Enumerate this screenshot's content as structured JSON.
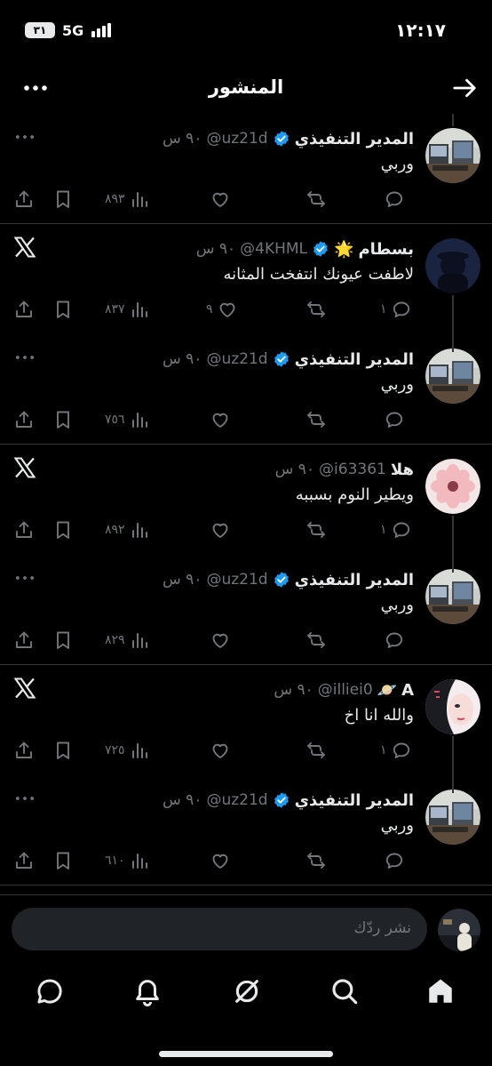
{
  "status_bar": {
    "time": "١٢:١٧",
    "network": "5G",
    "battery": "٣١"
  },
  "header": {
    "title": "المنشور",
    "back_icon": "arrow-right-icon",
    "more_icon": "more-horizontal-icon"
  },
  "posts": [
    {
      "name": "المدير التنفيذي",
      "handle": "@uz21d",
      "time": "٩٠ س",
      "verified": true,
      "emoji": "",
      "text": "وربي",
      "replies": "",
      "likes": "",
      "views": "٨٩٣",
      "avatar": "room",
      "corner": "more"
    },
    {
      "name": "بسطام",
      "handle": "@4KHML",
      "time": "٩٠ س",
      "verified": true,
      "emoji": "🌟",
      "text": "لاطفت عيونك انتفخت المثانه",
      "replies": "١",
      "likes": "٩",
      "views": "٨٣٧",
      "avatar": "night",
      "corner": "x"
    },
    {
      "name": "المدير التنفيذي",
      "handle": "@uz21d",
      "time": "٩٠ س",
      "verified": true,
      "emoji": "",
      "text": "وربي",
      "replies": "",
      "likes": "",
      "views": "٧٥٦",
      "avatar": "room",
      "corner": "more"
    },
    {
      "name": "هلا",
      "handle": "@i63361",
      "time": "٩٠ س",
      "verified": false,
      "emoji": "",
      "text": "ويطير النوم بسببه",
      "replies": "١",
      "likes": "",
      "views": "٨٩٢",
      "avatar": "flower",
      "corner": "x"
    },
    {
      "name": "المدير التنفيذي",
      "handle": "@uz21d",
      "time": "٩٠ س",
      "verified": true,
      "emoji": "",
      "text": "وربي",
      "replies": "",
      "likes": "",
      "views": "٨٢٩",
      "avatar": "room",
      "corner": "more"
    },
    {
      "name": "A",
      "handle": "@illiei0",
      "time": "٩٠ س",
      "verified": false,
      "emoji": "🪐",
      "text": "والله انا اخ",
      "replies": "١",
      "likes": "",
      "views": "٧٢٥",
      "avatar": "anime",
      "corner": "x"
    },
    {
      "name": "المدير التنفيذي",
      "handle": "@uz21d",
      "time": "٩٠ س",
      "verified": true,
      "emoji": "",
      "text": "وربي",
      "replies": "",
      "likes": "",
      "views": "٦١٠",
      "avatar": "room",
      "corner": "more"
    }
  ],
  "compose": {
    "placeholder": "نشر ردّك",
    "avatar": "user-avatar"
  },
  "tabbar": {
    "items": [
      "home-icon",
      "search-icon",
      "grok-icon",
      "notifications-icon",
      "messages-icon"
    ]
  },
  "colors": {
    "background": "#000000",
    "text": "#e7e9ea",
    "muted": "#71767b",
    "verified": "#1d9bf0",
    "divider": "#2f3336"
  }
}
